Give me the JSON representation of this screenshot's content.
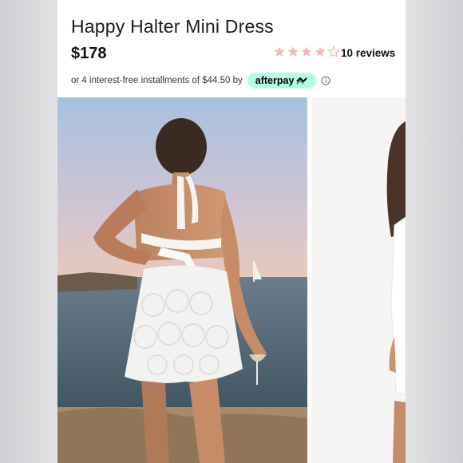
{
  "product": {
    "title": "Happy Halter Mini Dress",
    "price": "$178",
    "rating": 4,
    "rating_max": 5,
    "reviews_label": "10 reviews"
  },
  "afterpay": {
    "text": "or 4 interest-free installments of $44.50 by",
    "brand": "afterpay"
  },
  "icons": {
    "star": "star-icon",
    "info": "info-icon",
    "afterpay_logo": "afterpay-arrows-icon"
  },
  "colors": {
    "star_fill": "#f5b8b8",
    "afterpay_mint": "#b2fce4",
    "text": "#1c1c1c"
  }
}
